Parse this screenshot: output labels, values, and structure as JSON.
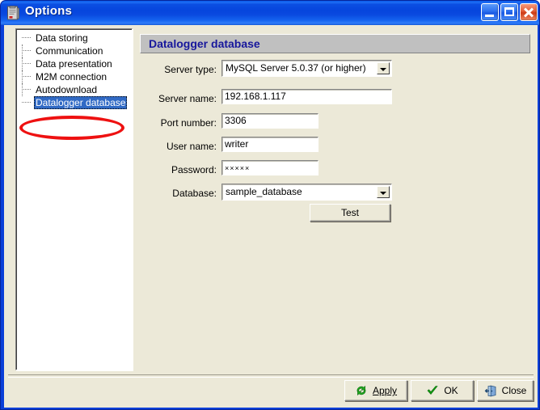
{
  "window": {
    "title": "Options",
    "icon": "datalogger-device-icon",
    "buttons": {
      "minimize": "Minimize",
      "maximize": "Maximize",
      "close": "Close"
    }
  },
  "tree": {
    "items": [
      {
        "label": "Data storing",
        "selected": false
      },
      {
        "label": "Communication",
        "selected": false
      },
      {
        "label": "Data presentation",
        "selected": false
      },
      {
        "label": "M2M connection",
        "selected": false
      },
      {
        "label": "Autodownload",
        "selected": false
      },
      {
        "label": "Datalogger database",
        "selected": true
      }
    ]
  },
  "annotation": {
    "shape": "red-ellipse-highlight",
    "color": "#ee1111",
    "target": "Datalogger database"
  },
  "pane": {
    "header": "Datalogger database",
    "fields": [
      {
        "label": "Server type:",
        "type": "combobox",
        "value": "MySQL Server 5.0.37 (or higher)",
        "name": "server-type"
      },
      {
        "label": "Server name:",
        "type": "textbox",
        "value": "192.168.1.117",
        "name": "server-name"
      },
      {
        "label": "Port number:",
        "type": "textbox",
        "value": "3306",
        "name": "port-number"
      },
      {
        "label": "User name:",
        "type": "textbox",
        "value": "writer",
        "name": "user-name"
      },
      {
        "label": "Password:",
        "type": "password",
        "value": "×××××",
        "name": "password"
      },
      {
        "label": "Database:",
        "type": "combobox",
        "value": "sample_database",
        "name": "database"
      }
    ],
    "test_button": "Test"
  },
  "footer": {
    "apply": "Apply",
    "apply_accel": "A",
    "ok": "OK",
    "close": "Close"
  },
  "colors": {
    "titlebar_blue": "#0a4ae0",
    "dialog_face": "#ece9d8",
    "header_grey": "#c0c0c0",
    "header_text": "#17179c",
    "selection_blue": "#316ac5",
    "annotation_red": "#ee1111"
  }
}
